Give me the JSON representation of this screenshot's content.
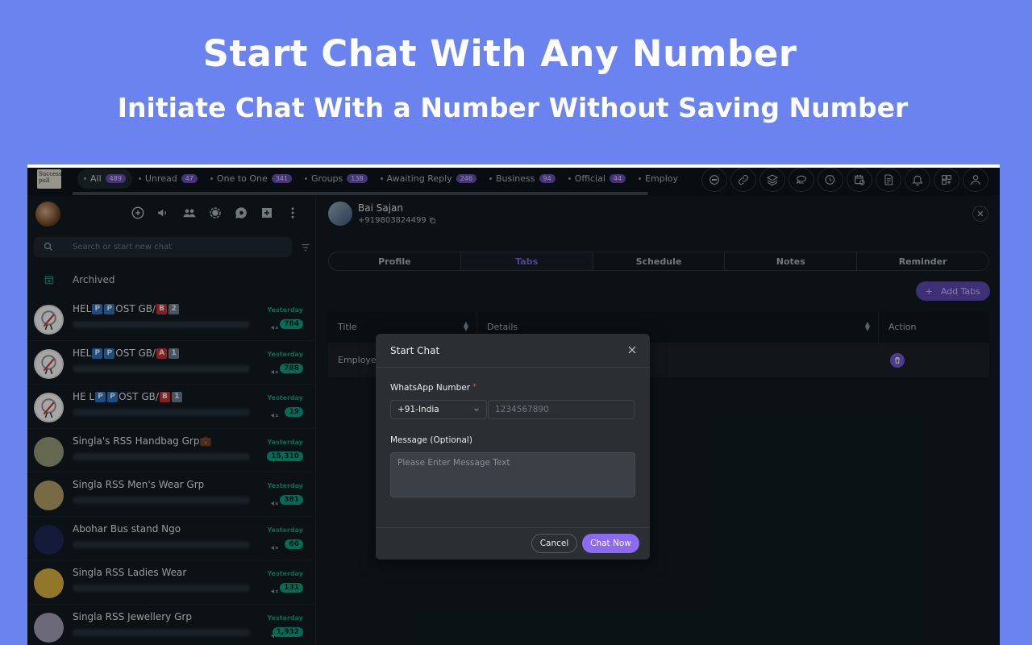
{
  "hero": {
    "title": "Start Chat With Any Number",
    "subtitle": "Initiate Chat With a Number Without Saving Number"
  },
  "filter_tabs": [
    {
      "label": "All",
      "count": "489",
      "active": true
    },
    {
      "label": "Unread",
      "count": "47"
    },
    {
      "label": "One to One",
      "count": "341"
    },
    {
      "label": "Groups",
      "count": "138"
    },
    {
      "label": "Awaiting Reply",
      "count": "246"
    },
    {
      "label": "Business",
      "count": "94"
    },
    {
      "label": "Official",
      "count": "44"
    },
    {
      "label": "Employ",
      "count": ""
    }
  ],
  "logo_text": "success pull",
  "top_icons": [
    "chat-bubble-icon",
    "link-icon",
    "layers-icon",
    "message-stack-icon",
    "clock-chat-icon",
    "calendar-clock-icon",
    "note-edit-icon",
    "bell-icon",
    "grid-plus-icon",
    "user-icon"
  ],
  "sidebar": {
    "search_placeholder": "Search or start new chat",
    "archived_label": "Archived",
    "chats": [
      {
        "name_parts": [
          "HEL",
          "P",
          "P",
          "OST GB/",
          "B",
          "2"
        ],
        "keys": [
          "blue",
          "blue",
          "red",
          "gray"
        ],
        "time": "Yesterday",
        "badge": "784",
        "avatar_color": "#e8e8e8"
      },
      {
        "name_parts": [
          "HEL",
          "P",
          "P",
          "OST GB/",
          "A",
          "1"
        ],
        "keys": [
          "blue",
          "blue",
          "red",
          "gray"
        ],
        "time": "Yesterday",
        "badge": "788",
        "avatar_color": "#e8e8e8"
      },
      {
        "name_parts": [
          "HE L",
          "P",
          "P",
          "OST GB/",
          "B",
          "1"
        ],
        "keys": [
          "blue",
          "blue",
          "red",
          "gray"
        ],
        "time": "Yesterday",
        "badge": "19",
        "avatar_color": "#e8e8e8"
      },
      {
        "name": "Singla's RSS Handbag Grp💼",
        "time": "Yesterday",
        "badge": "15,310",
        "avatar_color": "#9aa07a"
      },
      {
        "name": "Singla RSS Men's Wear Grp",
        "time": "Yesterday",
        "badge": "381",
        "avatar_color": "#b8a46a"
      },
      {
        "name": "Abohar Bus stand Ngo",
        "time": "Yesterday",
        "badge": "66",
        "avatar_color": "#1f2a5a"
      },
      {
        "name": "Singla RSS Ladies Wear",
        "time": "Yesterday",
        "badge": "131",
        "avatar_color": "#e0b640"
      },
      {
        "name": "Singla RSS Jewellery Grp",
        "time": "Yesterday",
        "badge": "1,932",
        "avatar_color": "#a7a3b8"
      }
    ]
  },
  "contact": {
    "name": "Bai Sajan",
    "phone": "+919803824499"
  },
  "segments": [
    {
      "label": "Profile"
    },
    {
      "label": "Tabs",
      "active": true
    },
    {
      "label": "Schedule"
    },
    {
      "label": "Notes"
    },
    {
      "label": "Reminder"
    }
  ],
  "add_tabs_label": "Add Tabs",
  "table": {
    "headers": [
      "Title",
      "Details",
      "Action"
    ],
    "rows": [
      {
        "title": "Employee"
      }
    ]
  },
  "modal": {
    "title": "Start Chat",
    "number_label": "WhatsApp Number",
    "required_mark": "*",
    "country_value": "+91-India",
    "phone_placeholder": "1234567890",
    "message_label": "Message (Optional)",
    "message_placeholder": "Please Enter Message Text",
    "cancel_label": "Cancel",
    "chat_now_label": "Chat Now"
  },
  "colors": {
    "background": "#6a83ef",
    "accent": "#8b6cf0",
    "badge_green": "#00a884"
  }
}
